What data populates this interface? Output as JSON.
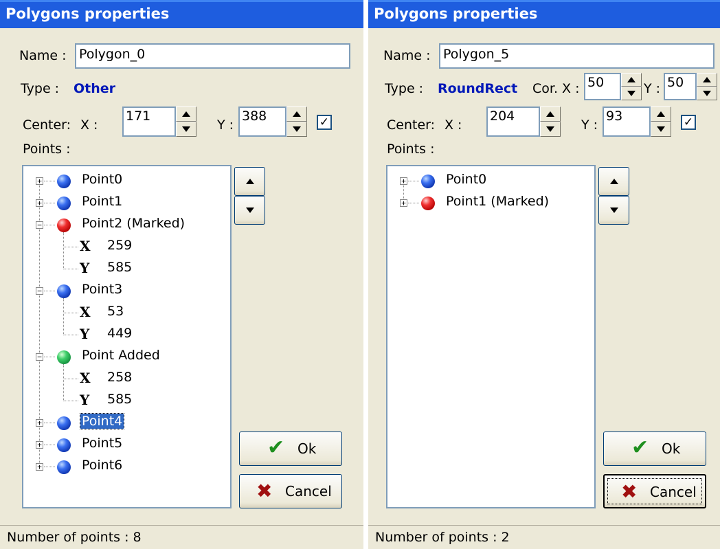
{
  "left": {
    "title": "Polygons properties",
    "name_label": "Name :",
    "name_value": "Polygon_0",
    "type_label": "Type :",
    "type_value": "Other",
    "center_label": "Center:",
    "x_label": "X :",
    "x_value": "171",
    "y_label": "Y :",
    "y_value": "388",
    "points_label": "Points :",
    "tree": [
      {
        "text": "Point0",
        "color": "blue",
        "expander": "+"
      },
      {
        "text": "Point1",
        "color": "blue",
        "expander": "+"
      },
      {
        "text": "Point2 (Marked)",
        "color": "red",
        "expander": "-",
        "x": "259",
        "y": "585"
      },
      {
        "text": "Point3",
        "color": "blue",
        "expander": "-",
        "x": "53",
        "y": "449"
      },
      {
        "text": "Point Added",
        "color": "green",
        "expander": "-",
        "x": "258",
        "y": "585"
      },
      {
        "text": "Point4",
        "color": "blue",
        "expander": "+",
        "selected": true
      },
      {
        "text": "Point5",
        "color": "blue",
        "expander": "+"
      },
      {
        "text": "Point6",
        "color": "blue",
        "expander": "+"
      }
    ],
    "ok_label": "Ok",
    "cancel_label": "Cancel",
    "status": "Number of points : 8"
  },
  "right": {
    "title": "Polygons properties",
    "name_label": "Name :",
    "name_value": "Polygon_5",
    "type_label": "Type :",
    "type_value": "RoundRect",
    "corx_label": "Cor. X :",
    "corx_value": "50",
    "cory_label": "Y :",
    "cory_value": "50",
    "center_label": "Center:",
    "x_label": "X :",
    "x_value": "204",
    "y_label": "Y :",
    "y_value": "93",
    "points_label": "Points :",
    "tree": [
      {
        "text": "Point0",
        "color": "blue",
        "expander": "+"
      },
      {
        "text": "Point1 (Marked)",
        "color": "red",
        "expander": "+"
      }
    ],
    "ok_label": "Ok",
    "cancel_label": "Cancel",
    "status": "Number of points : 2"
  },
  "colors": {
    "title_bar": "#1e5ddf",
    "selection": "#316ac5",
    "type_text": "#0018b8",
    "dialog_bg": "#ece9d8"
  }
}
